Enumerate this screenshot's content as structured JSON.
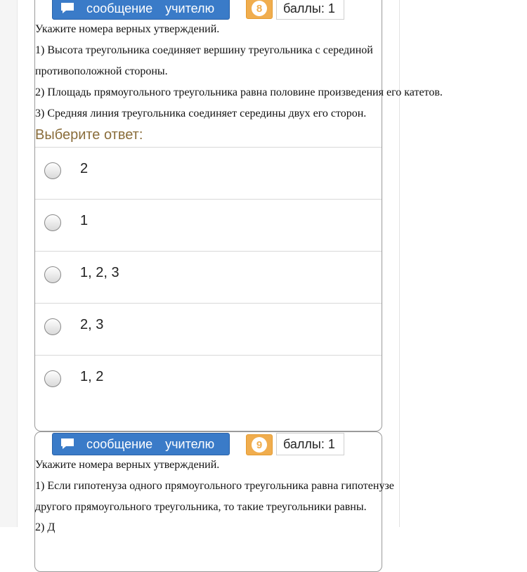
{
  "q8": {
    "message_button": {
      "word1": "сообщение",
      "word2": "учителю"
    },
    "number": "8",
    "points": "баллы: 1",
    "lines": [
      "Укажите номера верных утверждений.",
      "1) Высота треугольника соединяет вершину треугольника с серединой",
      "противоположной стороны.",
      "2) Площадь прямоугольного треугольника равна половине произведения его катетов.",
      "3) Средняя линия треугольника соединяет середины двух его сторон."
    ],
    "prompt": "Выберите ответ:",
    "options": [
      "2",
      "1",
      "1, 2, 3",
      "2, 3",
      "1, 2"
    ]
  },
  "q9": {
    "message_button": {
      "word1": "сообщение",
      "word2": "учителю"
    },
    "number": "9",
    "points": "баллы: 1",
    "lines": [
      "Укажите номера верных утверждений.",
      "1) Если гипотенуза одного прямоугольного треугольника равна гипотенузе",
      "другого прямоугольного треугольника, то такие треугольники равны.",
      "2) Д"
    ]
  },
  "icons": {
    "message": "comment-icon"
  },
  "colors": {
    "button_blue": "#3a7bc8",
    "badge_orange": "#f0ad4e",
    "prompt_brown": "#8a6d3b"
  }
}
